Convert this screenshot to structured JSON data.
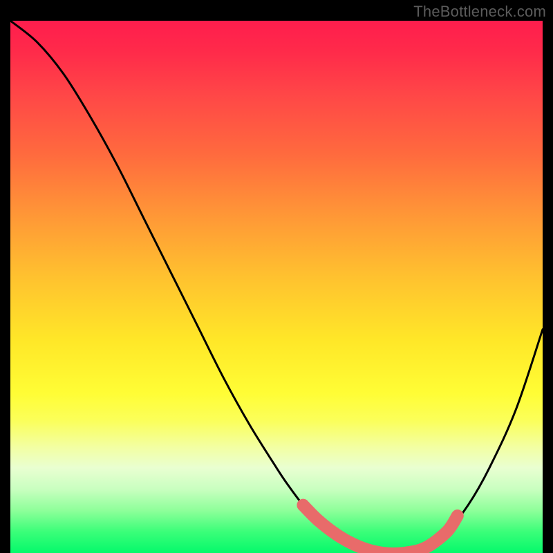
{
  "watermark": "TheBottleneck.com",
  "chart_data": {
    "type": "line",
    "title": "",
    "xlabel": "",
    "ylabel": "",
    "xlim": [
      0,
      100
    ],
    "ylim": [
      0,
      100
    ],
    "grid": false,
    "series": [
      {
        "name": "bottleneck-curve",
        "color": "#000000",
        "x": [
          0,
          5,
          10,
          15,
          20,
          25,
          30,
          35,
          40,
          45,
          50,
          52,
          55,
          58,
          62,
          66,
          70,
          74,
          78,
          82,
          86,
          90,
          95,
          100
        ],
        "values": [
          100,
          96,
          90,
          82,
          73,
          63,
          53,
          43,
          33,
          24,
          16,
          13,
          9,
          6,
          3,
          1,
          0,
          0,
          1,
          4,
          9,
          16,
          27,
          42
        ]
      },
      {
        "name": "sweet-zone-highlight",
        "color": "#e86b6a",
        "x": [
          55,
          58,
          62,
          66,
          70,
          74,
          78,
          82,
          84
        ],
        "values": [
          9,
          6,
          3,
          1,
          0,
          0,
          1,
          4,
          7
        ]
      }
    ],
    "highlight_dots": {
      "color": "#e86b6a",
      "points": [
        {
          "x": 55,
          "y": 9
        },
        {
          "x": 58,
          "y": 6
        }
      ]
    }
  }
}
